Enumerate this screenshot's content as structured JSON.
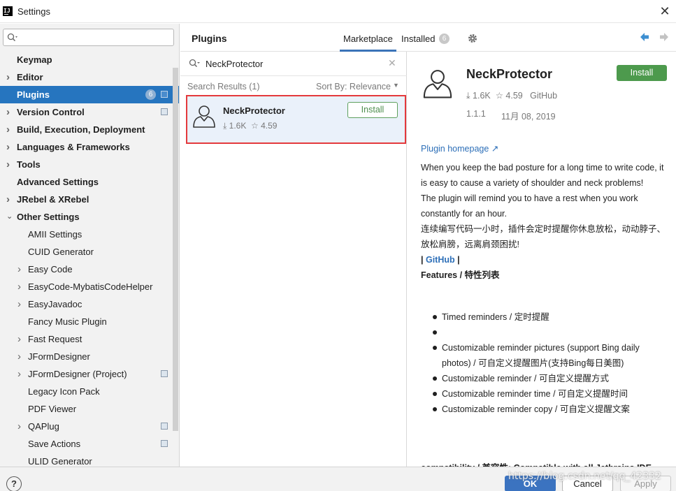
{
  "window": {
    "title": "Settings",
    "close_glyph": "✕"
  },
  "sidebar": {
    "search_placeholder": "",
    "items": [
      {
        "label": "Keymap",
        "bold": true,
        "arrow": false,
        "child": false
      },
      {
        "label": "Editor",
        "bold": true,
        "arrow": true,
        "child": false
      },
      {
        "label": "Plugins",
        "bold": true,
        "arrow": false,
        "child": false,
        "selected": true,
        "badge": "6",
        "project": true
      },
      {
        "label": "Version Control",
        "bold": true,
        "arrow": true,
        "child": false,
        "project": true
      },
      {
        "label": "Build, Execution, Deployment",
        "bold": true,
        "arrow": true,
        "child": false
      },
      {
        "label": "Languages & Frameworks",
        "bold": true,
        "arrow": true,
        "child": false
      },
      {
        "label": "Tools",
        "bold": true,
        "arrow": true,
        "child": false
      },
      {
        "label": "Advanced Settings",
        "bold": true,
        "arrow": false,
        "child": false
      },
      {
        "label": "JRebel & XRebel",
        "bold": true,
        "arrow": true,
        "child": false
      },
      {
        "label": "Other Settings",
        "bold": true,
        "arrow": true,
        "expanded": true,
        "child": false
      },
      {
        "label": "AMII Settings",
        "bold": false,
        "arrow": false,
        "child": true
      },
      {
        "label": "CUID Generator",
        "bold": false,
        "arrow": false,
        "child": true
      },
      {
        "label": "Easy Code",
        "bold": false,
        "arrow": true,
        "child": true
      },
      {
        "label": "EasyCode-MybatisCodeHelper",
        "bold": false,
        "arrow": true,
        "child": true
      },
      {
        "label": "EasyJavadoc",
        "bold": false,
        "arrow": true,
        "child": true
      },
      {
        "label": "Fancy Music Plugin",
        "bold": false,
        "arrow": false,
        "child": true
      },
      {
        "label": "Fast Request",
        "bold": false,
        "arrow": true,
        "child": true
      },
      {
        "label": "JFormDesigner",
        "bold": false,
        "arrow": true,
        "child": true
      },
      {
        "label": "JFormDesigner (Project)",
        "bold": false,
        "arrow": true,
        "child": true,
        "project": true
      },
      {
        "label": "Legacy Icon Pack",
        "bold": false,
        "arrow": false,
        "child": true
      },
      {
        "label": "PDF Viewer",
        "bold": false,
        "arrow": false,
        "child": true
      },
      {
        "label": "QAPlug",
        "bold": false,
        "arrow": true,
        "child": true,
        "project": true
      },
      {
        "label": "Save Actions",
        "bold": false,
        "arrow": false,
        "child": true,
        "project": true
      },
      {
        "label": "ULID Generator",
        "bold": false,
        "arrow": false,
        "child": true
      }
    ]
  },
  "plugins": {
    "title": "Plugins",
    "tabs": {
      "marketplace": "Marketplace",
      "installed": "Installed",
      "installed_badge": "6"
    }
  },
  "search": {
    "query": "NeckProtector",
    "results_label": "Search Results (1)",
    "sort_label": "Sort By: Relevance"
  },
  "result": {
    "name": "NeckProtector",
    "downloads": "1.6K",
    "rating": "4.59",
    "install_label": "Install"
  },
  "detail": {
    "name": "NeckProtector",
    "downloads": "1.6K",
    "rating": "4.59",
    "vendor": "GitHub",
    "version": "1.1.1",
    "date": "11月 08, 2019",
    "install_label": "Install",
    "homepage": "Plugin homepage ↗",
    "desc_en_1": "When you keep the bad posture for a long time to write code, it is easy to cause a variety of shoulder and neck problems!",
    "desc_en_2": "The plugin will remind you to have a rest when you work constantly for an hour.",
    "desc_cn": "连续编写代码一小时，插件会定时提醒你休息放松，动动脖子、放松肩膀，远离肩颈困扰!",
    "github_prefix": "| ",
    "github_link": "GitHub",
    "github_suffix": " |",
    "features_title": "Features / 特性列表",
    "features": [
      "Timed reminders / 定时提醒",
      "",
      "Customizable reminder pictures (support Bing daily photos) / 可自定义提醒图片(支持Bing每日美图)",
      "Customizable reminder / 可自定义提醒方式",
      "Customizable reminder time / 可自定义提醒时间",
      "Customizable reminder copy / 可自定义提醒文案"
    ],
    "compat": "compatibility / 兼容性: Compatible with all Jetbrains IDE"
  },
  "footer": {
    "help": "?",
    "ok": "OK",
    "cancel": "Cancel",
    "apply": "Apply",
    "watermark": "https://blog.csdn.net/qq_42332"
  },
  "colors": {
    "accent": "#2675bf",
    "install_green": "#4d9a4d",
    "highlight_border": "#e4393c"
  }
}
